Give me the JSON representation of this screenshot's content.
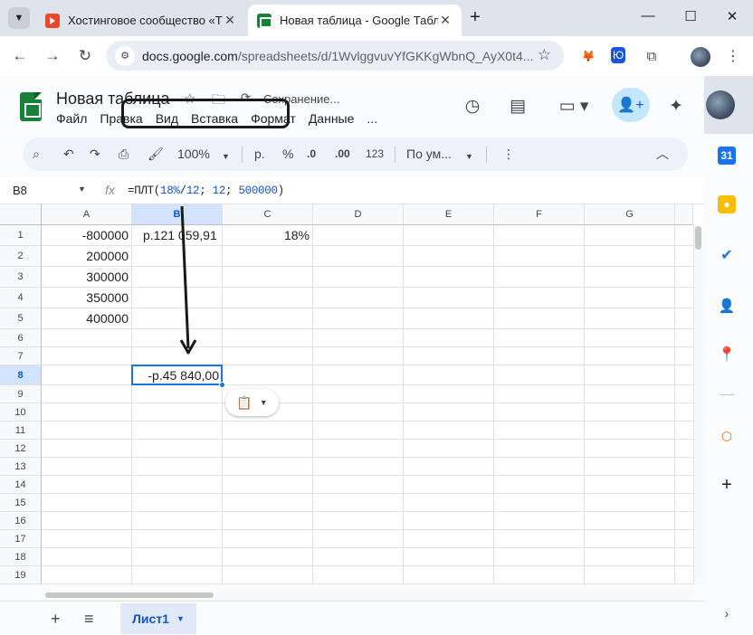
{
  "browser": {
    "tabs": [
      {
        "title": "Хостинговое сообщество «Tim",
        "favicon": "timeweb-icon",
        "active": false
      },
      {
        "title": "Новая таблица - Google Табли",
        "favicon": "sheets-icon",
        "active": true
      }
    ],
    "url_host": "docs.google.com",
    "url_path": "/spreadsheets/d/1WvlggvuvYfGKKgWbnQ_AyX0t4..."
  },
  "doc": {
    "title": "Новая таблица",
    "status": "Сохранение...",
    "menu": [
      "Файл",
      "Правка",
      "Вид",
      "Вставка",
      "Формат",
      "Данные",
      "..."
    ]
  },
  "toolbar": {
    "zoom": "100%",
    "currency": "р.",
    "percent": "%",
    "dec_decrease": ".0",
    "dec_increase": ".00",
    "number_format": "123",
    "font": "По ум..."
  },
  "formula_bar": {
    "cell_ref": "B8",
    "fx": "fx",
    "formula_prefix": "=ПЛТ(",
    "arg1": "18%",
    "arg1_suffix": "/",
    "arg2": "12",
    "sep1": "; ",
    "arg3": "12",
    "sep2": "; ",
    "arg4": "500000",
    "formula_suffix": ")"
  },
  "grid": {
    "columns": [
      "A",
      "B",
      "C",
      "D",
      "E",
      "F",
      "G"
    ],
    "rows": [
      "1",
      "2",
      "3",
      "4",
      "5",
      "6",
      "7",
      "8",
      "9",
      "10",
      "11",
      "12",
      "13",
      "14",
      "15",
      "16",
      "17",
      "18",
      "19"
    ],
    "cells": {
      "A1": "-800000",
      "A2": "200000",
      "A3": "300000",
      "A4": "350000",
      "A5": "400000",
      "B1": "р.121 059,91",
      "C1": "18%",
      "B8": "-р.45 840,00"
    }
  },
  "sheets": {
    "active_sheet": "Лист1"
  },
  "colors": {
    "accent": "#1a73e8",
    "sheets_green": "#188038",
    "share_bg": "#c2e7ff"
  }
}
